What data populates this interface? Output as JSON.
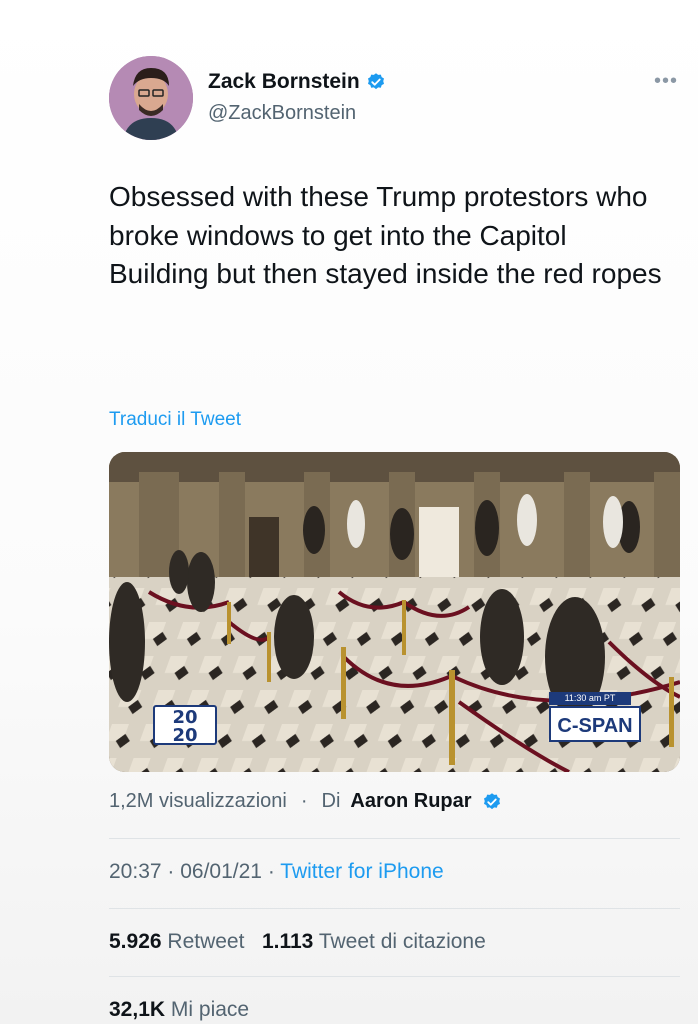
{
  "tweet": {
    "author_name": "Zack Bornstein",
    "author_handle": "@ZackBornstein",
    "more_icon": "more-horizontal-icon",
    "text": "Obsessed with these Trump protestors who broke windows to get into the Capitol Building but then stayed inside the red ropes",
    "translate_label": "Traduci il Tweet"
  },
  "media": {
    "overlay_left": "20⁮20",
    "overlay_left_top": "20",
    "overlay_left_bottom": "20",
    "time_tag": "11:30 am PT",
    "channel": "C-SPAN"
  },
  "meta": {
    "views": "1,2M visualizzazioni",
    "separator": "·",
    "by_label": "Di",
    "video_author": "Aaron Rupar",
    "time": "20:37",
    "date": "06/01/21",
    "source": "Twitter for iPhone"
  },
  "stats": {
    "retweets_value": "5.926",
    "retweets_label": "Retweet",
    "quotes_value": "1.113",
    "quotes_label": "Tweet di citazione",
    "likes_value": "32,1K",
    "likes_label": "Mi piace"
  },
  "colors": {
    "link": "#1d9bf0",
    "verified": "#1d9bf0",
    "text": "#0f1419",
    "secondary": "#536471"
  }
}
